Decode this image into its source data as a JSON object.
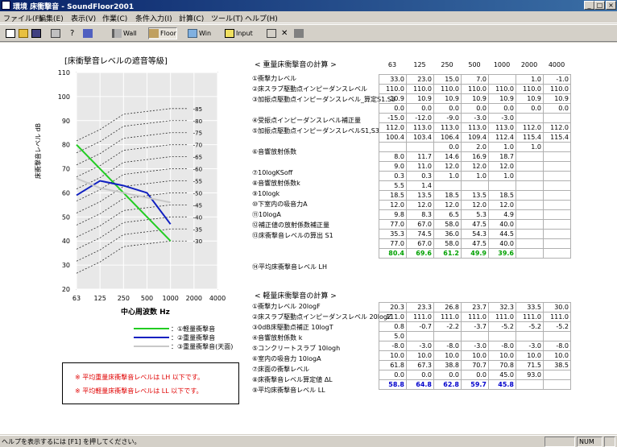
{
  "app": {
    "title": "床衝撃音 - SoundFloor2001",
    "title_prefix": "環境"
  },
  "menu": [
    "ファイル(F)",
    "編集(E)",
    "表示(V)",
    "作業(C)",
    "条件入力(I)",
    "計算(C)",
    "ツール(T)",
    "ヘルプ(H)"
  ],
  "toolbar": {
    "wall": "Wall",
    "floor": "Floor",
    "win": "Win",
    "input": "Input"
  },
  "chart": {
    "title": "[床衝撃音レベルの遮音等級]",
    "ylabel": "床衝撃音レベル dB",
    "xlabel": "中心周波数 Hz"
  },
  "legend": [
    "：①軽量衝撃音",
    "：②重量衝撃音",
    "：③重量衝撃音(天面)"
  ],
  "notes": [
    "※ 平均重量床衝撃音レベルは LH 以下です。",
    "※ 平均軽量床衝撃音レベルは LL 以下です。"
  ],
  "heavy": {
    "title": "< 重量床衝撃音の計算 >",
    "headers": [
      "63",
      "125",
      "250",
      "500",
      "1000",
      "2000",
      "4000"
    ],
    "labels": [
      "①衝撃力レベル",
      "②床スラブ駆動点インピーダンスレベル",
      "③加振点駆動点インピーダンスレベル_算定S1.S3",
      "",
      "④受振点インピーダンスレベル補正量",
      "⑤加振点駆動点インピーダンスレベルS1,S3",
      "",
      "⑥音響放射係数",
      "",
      "⑦10logKSoff",
      "⑧音響放射係数k",
      "⑨10logk",
      "⑩下室内の吸音力A",
      "⑪10logA",
      "⑫補正値の放射係数補正量",
      "⑬床衝撃音レベルの算出 S1",
      "",
      "",
      "⑭平均床衝撃音レベル LH"
    ],
    "rows": [
      [
        "33.0",
        "23.0",
        "15.0",
        "7.0",
        "",
        "1.0",
        "-1.0"
      ],
      [
        "110.0",
        "110.0",
        "110.0",
        "110.0",
        "110.0",
        "110.0",
        "110.0"
      ],
      [
        "10.9",
        "10.9",
        "10.9",
        "10.9",
        "10.9",
        "10.9",
        "10.9"
      ],
      [
        "0.0",
        "0.0",
        "0.0",
        "0.0",
        "0.0",
        "0.0",
        "0.0"
      ],
      [
        "-15.0",
        "-12.0",
        "-9.0",
        "-3.0",
        "-3.0",
        "",
        ""
      ],
      [
        "112.0",
        "113.0",
        "113.0",
        "113.0",
        "113.0",
        "112.0",
        "112.0"
      ],
      [
        "100.4",
        "103.4",
        "106.4",
        "109.4",
        "112.4",
        "115.4",
        "115.4"
      ],
      [
        "",
        "",
        "0.0",
        "2.0",
        "1.0",
        "1.0",
        ""
      ],
      [
        "8.0",
        "11.7",
        "14.6",
        "16.9",
        "18.7",
        "",
        ""
      ],
      [
        "9.0",
        "11.0",
        "12.0",
        "12.0",
        "12.0",
        "",
        ""
      ],
      [
        "0.3",
        "0.3",
        "1.0",
        "1.0",
        "1.0",
        "",
        ""
      ],
      [
        "5.5",
        "1.4",
        "",
        "",
        "",
        "",
        ""
      ],
      [
        "18.5",
        "13.5",
        "18.5",
        "13.5",
        "18.5",
        "",
        ""
      ],
      [
        "12.0",
        "12.0",
        "12.0",
        "12.0",
        "12.0",
        "",
        ""
      ],
      [
        "9.8",
        "8.3",
        "6.5",
        "5.3",
        "4.9",
        "",
        ""
      ],
      [
        "77.0",
        "67.0",
        "58.0",
        "47.5",
        "40.0",
        "",
        ""
      ],
      [
        "35.3",
        "74.5",
        "36.0",
        "54.3",
        "44.5",
        "",
        ""
      ],
      [
        "77.0",
        "67.0",
        "58.0",
        "47.5",
        "40.0",
        "",
        ""
      ],
      [
        "80.4",
        "69.6",
        "61.2",
        "49.9",
        "39.6",
        "",
        ""
      ]
    ]
  },
  "light": {
    "title": "< 軽量床衝撃音の計算 >",
    "labels": [
      "①衝撃力レベル 20logF",
      "②床スラブ駆動点インピーダンスレベル 20logZ",
      "③0dB床駆動点補正 10logT",
      "④音響放射係数 k",
      "⑤コンクリートスラブ 10logh",
      "⑥室内の吸音力 10logA",
      "⑦床面の衝撃レベル",
      "⑧床衝撃音レベル算定値 ΔL",
      "⑨平均床衝撃音レベル LL"
    ],
    "rows": [
      [
        "20.3",
        "23.3",
        "26.8",
        "23.7",
        "32.3",
        "33.5",
        "30.0"
      ],
      [
        "111.0",
        "111.0",
        "111.0",
        "111.0",
        "111.0",
        "111.0",
        "111.0"
      ],
      [
        "0.8",
        "-0.7",
        "-2.2",
        "-3.7",
        "-5.2",
        "-5.2",
        "-5.2"
      ],
      [
        "5.0",
        "",
        "",
        "",
        "",
        "",
        ""
      ],
      [
        "-8.0",
        "-3.0",
        "-8.0",
        "-3.0",
        "-8.0",
        "-3.0",
        "-8.0"
      ],
      [
        "10.0",
        "10.0",
        "10.0",
        "10.0",
        "10.0",
        "10.0",
        "10.0"
      ],
      [
        "61.8",
        "67.3",
        "38.8",
        "70.7",
        "70.8",
        "71.5",
        "38.5"
      ],
      [
        "0.0",
        "0.0",
        "0.0",
        "0.0",
        "45.0",
        "93.0",
        ""
      ],
      [
        "58.8",
        "64.8",
        "62.8",
        "59.7",
        "45.8",
        "",
        ""
      ]
    ]
  },
  "status": {
    "message": "ヘルプを表示するには [F1] を押してください。",
    "num": "NUM"
  },
  "chart_data": {
    "type": "line",
    "title": "[床衝撃音レベルの遮音等級]",
    "xlabel": "中心周波数 Hz",
    "ylabel": "床衝撃音レベル dB",
    "categories": [
      "63",
      "125",
      "250",
      "500",
      "1000",
      "2000",
      "4000"
    ],
    "ylim": [
      20,
      110
    ],
    "series": [
      {
        "name": "①軽量衝撃音",
        "color": "#22cc22",
        "values": [
          80,
          70,
          60,
          50,
          40
        ]
      },
      {
        "name": "②重量衝撃音",
        "color": "#1020c0",
        "values": [
          59,
          65,
          63,
          60,
          47
        ]
      },
      {
        "name": "③重量衝撃音(天面)",
        "color": "#c8c8c8",
        "values": [
          66,
          62,
          60,
          58,
          56
        ]
      }
    ],
    "curves": [
      {
        "label": "-85"
      },
      {
        "label": "-80"
      },
      {
        "label": "-75"
      },
      {
        "label": "-70"
      },
      {
        "label": "-65"
      },
      {
        "label": "-60"
      },
      {
        "label": "-55"
      },
      {
        "label": "-50"
      },
      {
        "label": "-45"
      },
      {
        "label": "-40"
      },
      {
        "label": "-35"
      },
      {
        "label": "-30"
      }
    ]
  }
}
